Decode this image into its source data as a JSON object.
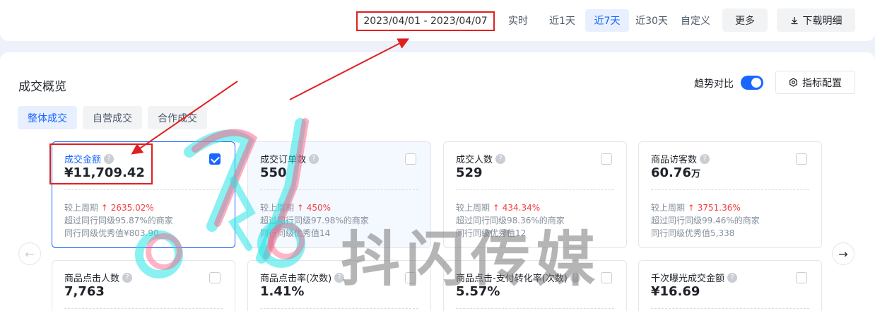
{
  "header": {
    "date_range": "2023/04/01 - 2023/04/07",
    "ranges": [
      {
        "label": "实时",
        "active": false
      },
      {
        "label": "近1天",
        "active": false
      },
      {
        "label": "近7天",
        "active": true
      },
      {
        "label": "近30天",
        "active": false
      },
      {
        "label": "自定义",
        "active": false
      }
    ],
    "more_label": "更多",
    "download_label": "下载明细",
    "download_icon": "download-icon"
  },
  "overview": {
    "title": "成交概览",
    "trend_label": "趋势对比",
    "trend_enabled": true,
    "config_label": "指标配置",
    "config_icon": "gear-icon",
    "tabs": [
      {
        "label": "整体成交",
        "active": true
      },
      {
        "label": "自营成交",
        "active": false
      },
      {
        "label": "合作成交",
        "active": false
      }
    ]
  },
  "cards": [
    {
      "label": "成交金额",
      "value": "¥11,709.42",
      "unit": "",
      "checked": true,
      "compare_label": "较上周期",
      "change": "2635.02%",
      "line2": "超过同行同级95.87%的商家",
      "line3": "同行同级优秀值¥803.90"
    },
    {
      "label": "成交订单数",
      "value": "550",
      "unit": "",
      "checked": false,
      "compare_label": "较上周期",
      "change": "450%",
      "line2": "超过同行同级97.98%的商家",
      "line3": "同行同级优秀值14"
    },
    {
      "label": "成交人数",
      "value": "529",
      "unit": "",
      "checked": false,
      "compare_label": "较上周期",
      "change": "434.34%",
      "line2": "超过同行同级98.36%的商家",
      "line3": "同行同级优秀值12"
    },
    {
      "label": "商品访客数",
      "value": "60.76",
      "unit": "万",
      "checked": false,
      "compare_label": "较上周期",
      "change": "3751.36%",
      "line2": "超过同行同级99.46%的商家",
      "line3": "同行同级优秀值5,338"
    },
    {
      "label": "商品点击人数",
      "value": "7,763",
      "unit": "",
      "checked": false
    },
    {
      "label": "商品点击率(次数)",
      "value": "1.41%",
      "unit": "",
      "checked": false
    },
    {
      "label": "商品点击-支付转化率(次数)",
      "value": "5.57%",
      "unit": "",
      "checked": false
    },
    {
      "label": "千次曝光成交金额",
      "value": "¥16.69",
      "unit": "",
      "checked": false
    }
  ],
  "nav": {
    "prev_icon": "arrow-left-icon",
    "next_icon": "arrow-right-icon"
  },
  "watermark": {
    "text": "抖闪传媒"
  },
  "colors": {
    "accent": "#1966ff",
    "up": "#f53f3f",
    "annotation": "#e02020"
  }
}
